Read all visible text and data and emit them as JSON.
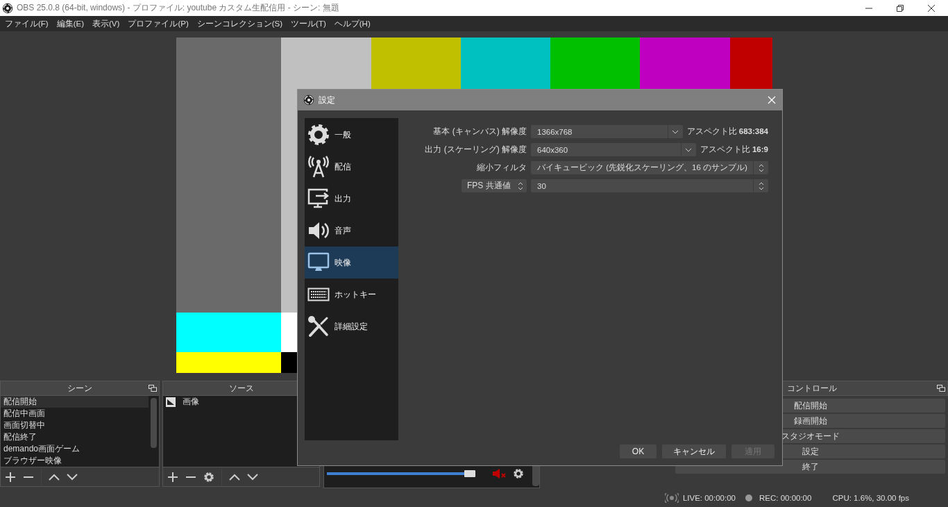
{
  "window": {
    "title": "OBS 25.0.8 (64-bit, windows) - プロファイル: youtube カスタム生配信用 - シーン: 無題"
  },
  "menu": [
    "ファイル(F)",
    "編集(E)",
    "表示(V)",
    "プロファイル(P)",
    "シーンコレクション(S)",
    "ツール(T)",
    "ヘルプ(H)"
  ],
  "scenes": {
    "title": "シーン",
    "items": [
      {
        "label": "配信開始",
        "selected": true
      },
      {
        "label": "配信中画面",
        "selected": false
      },
      {
        "label": "画面切替中",
        "selected": false
      },
      {
        "label": "配信終了",
        "selected": false
      },
      {
        "label": "demando画面ゲーム",
        "selected": false
      },
      {
        "label": "ブラウザー映像",
        "selected": false
      }
    ]
  },
  "sources": {
    "title": "ソース",
    "items": [
      {
        "label": "画像"
      }
    ]
  },
  "mixer": {
    "volume": {
      "level": 0.93
    },
    "muted": true
  },
  "controls": {
    "title": "コントロール",
    "buttons": [
      "配信開始",
      "録画開始",
      "スタジオモード",
      "設定",
      "終了"
    ]
  },
  "status": {
    "live": "LIVE: 00:00:00",
    "rec": "REC: 00:00:00",
    "cpu": "CPU: 1.6%, 30.00 fps"
  },
  "settings": {
    "title": "設定",
    "categories": [
      {
        "label": "一般",
        "selected": false
      },
      {
        "label": "配信",
        "selected": false
      },
      {
        "label": "出力",
        "selected": false
      },
      {
        "label": "音声",
        "selected": false
      },
      {
        "label": "映像",
        "selected": true
      },
      {
        "label": "ホットキー",
        "selected": false
      },
      {
        "label": "詳細設定",
        "selected": false
      }
    ],
    "rows": [
      {
        "kind": "dropdown",
        "label": "基本 (キャンバス) 解像度",
        "value": "1366x768",
        "note": "アスペクト比 **683:384**"
      },
      {
        "kind": "dropdown",
        "label": "出力 (スケーリング) 解像度",
        "value": "640x360",
        "note": "アスペクト比 **16:9**"
      },
      {
        "kind": "spin",
        "label": "縮小フィルタ",
        "value": "バイキュービック (先鋭化スケーリング、16 のサンプル)"
      },
      {
        "kind": "spin",
        "selector": "FPS 共通値",
        "value": "30"
      }
    ],
    "buttons": [
      {
        "label": "OK",
        "disabled": false
      },
      {
        "label": "キャンセル",
        "disabled": false
      },
      {
        "label": "適用",
        "disabled": true
      }
    ]
  }
}
